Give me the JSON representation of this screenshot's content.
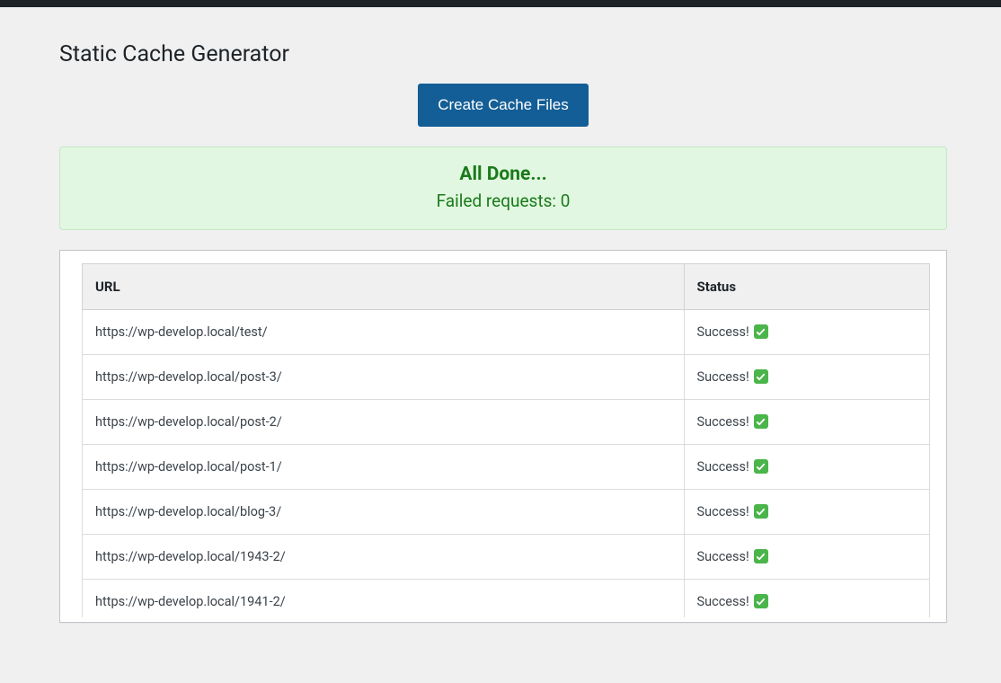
{
  "page": {
    "title": "Static Cache Generator",
    "button_label": "Create Cache Files"
  },
  "notice": {
    "title": "All Done...",
    "subtitle_prefix": "Failed requests: ",
    "failed_count": "0"
  },
  "table": {
    "headers": {
      "url": "URL",
      "status": "Status"
    },
    "success_label": "Success!",
    "rows": [
      {
        "url": "https://wp-develop.local/test/"
      },
      {
        "url": "https://wp-develop.local/post-3/"
      },
      {
        "url": "https://wp-develop.local/post-2/"
      },
      {
        "url": "https://wp-develop.local/post-1/"
      },
      {
        "url": "https://wp-develop.local/blog-3/"
      },
      {
        "url": "https://wp-develop.local/1943-2/"
      },
      {
        "url": "https://wp-develop.local/1941-2/"
      }
    ]
  }
}
